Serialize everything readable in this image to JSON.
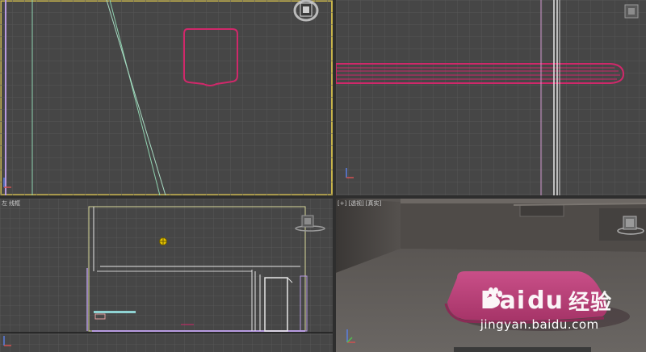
{
  "viewports": {
    "top_left": {
      "label_parts": []
    },
    "top_right": {
      "label_parts": []
    },
    "bottom_left": {
      "label_parts": [
        "左",
        "线框"
      ]
    },
    "bottom_right": {
      "label_parts": [
        "[+]",
        "[透视]",
        "[真实]"
      ]
    }
  },
  "watermark": {
    "brand": "Bai",
    "brand_tail": "du",
    "cn": "经验",
    "url": "jingyan.baidu.com"
  },
  "colors": {
    "viewport_bg": "#464646",
    "grid": "#555555",
    "active_border": "#c8b44a",
    "object_pink": "#d0286a",
    "line_green": "#8fd3b0",
    "line_purple": "#b79be0",
    "line_white": "#e6e6e6",
    "line_yellow": "#d8d89a"
  },
  "icons": {
    "viewcube": "viewcube-icon",
    "axis": "axis-tripod-icon",
    "pivot": "pivot-crosshair-icon"
  }
}
